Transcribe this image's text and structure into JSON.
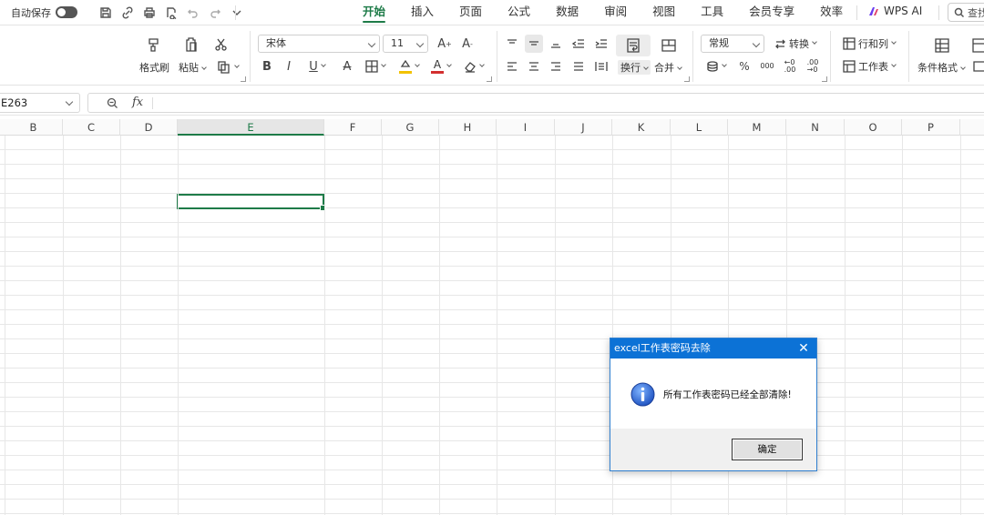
{
  "topbar": {
    "autosave_label": "自动保存",
    "tabs": [
      "开始",
      "插入",
      "页面",
      "公式",
      "数据",
      "审阅",
      "视图",
      "工具",
      "会员专享",
      "效率"
    ],
    "active_tab": "开始",
    "wps_ai_label": "WPS AI",
    "search_label": "查找"
  },
  "ribbon": {
    "format_painter": "格式刷",
    "paste": "粘贴",
    "font_name": "宋体",
    "font_size": "11",
    "wrap_text": "换行",
    "merge": "合并",
    "number_format": "常规",
    "convert": "转换",
    "rows_cols": "行和列",
    "worksheet": "工作表",
    "conditional_format": "条件格式",
    "font_color": "#d32f2f",
    "fill_color": "#f2c200"
  },
  "formula_bar": {
    "name_box": "E263",
    "fx": "fx"
  },
  "columns": [
    "B",
    "C",
    "D",
    "E",
    "F",
    "G",
    "H",
    "I",
    "J",
    "K",
    "L",
    "M",
    "N",
    "O",
    "P"
  ],
  "selected_column": "E",
  "dialog": {
    "title": "excel工作表密码去除",
    "message": "所有工作表密码已经全部清除!",
    "ok_label": "确定"
  }
}
